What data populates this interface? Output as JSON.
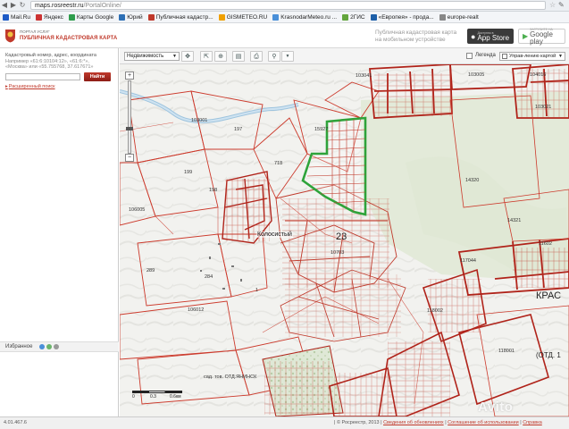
{
  "browser": {
    "url_host": "maps.rosreestr.ru",
    "url_path": "/PortalOnline/",
    "bookmarks": [
      {
        "label": "Mail.Ru",
        "color": "#1e5bc6"
      },
      {
        "label": "Яндекс",
        "color": "#cc3333"
      },
      {
        "label": "Карты Google",
        "color": "#2e9d4c"
      },
      {
        "label": "Юрий",
        "color": "#2d6fb5"
      },
      {
        "label": "Публичная кадастр...",
        "color": "#c0392b"
      },
      {
        "label": "GISMETEO.RU",
        "color": "#f0a000"
      },
      {
        "label": "KrasnodarMeteo.ru ...",
        "color": "#4a90d9"
      },
      {
        "label": "2ГИС",
        "color": "#63a53d"
      },
      {
        "label": "«Европея» - прода...",
        "color": "#1d5fa8"
      },
      {
        "label": "europe-realt",
        "color": "#888888"
      }
    ]
  },
  "header": {
    "portal_small": "ПОРТАЛ УСЛУГ",
    "portal_title": "ПУБЛИЧНАЯ КАДАСТРОВАЯ КАРТА",
    "promo_line1": "Публичная кадастровая карта",
    "promo_line2": "на мобильном устройстве",
    "appstore_small": "Доступно в",
    "appstore_big": "App Store",
    "gplay_small": "ЗАГРУЗИТЕ НА",
    "gplay_big": "Google play"
  },
  "search": {
    "line1": "Кадастровый номер, адрес, координата",
    "line2": "Например «61:6:10104:12», «61:6:*»,",
    "line3": "«Москва» или «55.755768, 37.617671»",
    "find_label": "Найти",
    "advanced_label": "Расширенный поиск",
    "favorites_label": "Избранное"
  },
  "toolbar": {
    "realty_type": "Недвижимость",
    "legend_label": "Легенда",
    "map_type": "Управ-лению картой"
  },
  "map": {
    "labels": {
      "l103041": "103041",
      "l103005": "103005",
      "l104016": "104016",
      "l103021": "103021",
      "l103001": "103001",
      "l197": "197",
      "l15927": "15927",
      "l199": "199",
      "l198": "198",
      "l718": "718",
      "l106005": "106005",
      "l14320": "14320",
      "l14321": "14321",
      "l23": "23",
      "l10703": "10703",
      "l117044": "117044",
      "l11602": "11602",
      "l289": "289",
      "l284": "284",
      "l1": "1",
      "l106012": "106012",
      "l118001": "118001",
      "lotd": "(ОТД. 1",
      "lkras": "КРАС",
      "l118002": "118002",
      "lotdbottom": "сад. тов. ОТД.ЯНИНСК"
    },
    "place_name": "Колосистый",
    "scale_labels": [
      "0",
      "0.3",
      "0.6км"
    ]
  },
  "status": {
    "version": "4.01.467.6",
    "copyright": "| © Росреестр, 2013 |",
    "updates_link": "Сведения об обновлениях",
    "terms_link": "Соглашение об использовании",
    "help_link": "Справка"
  },
  "watermark": "Avito"
}
